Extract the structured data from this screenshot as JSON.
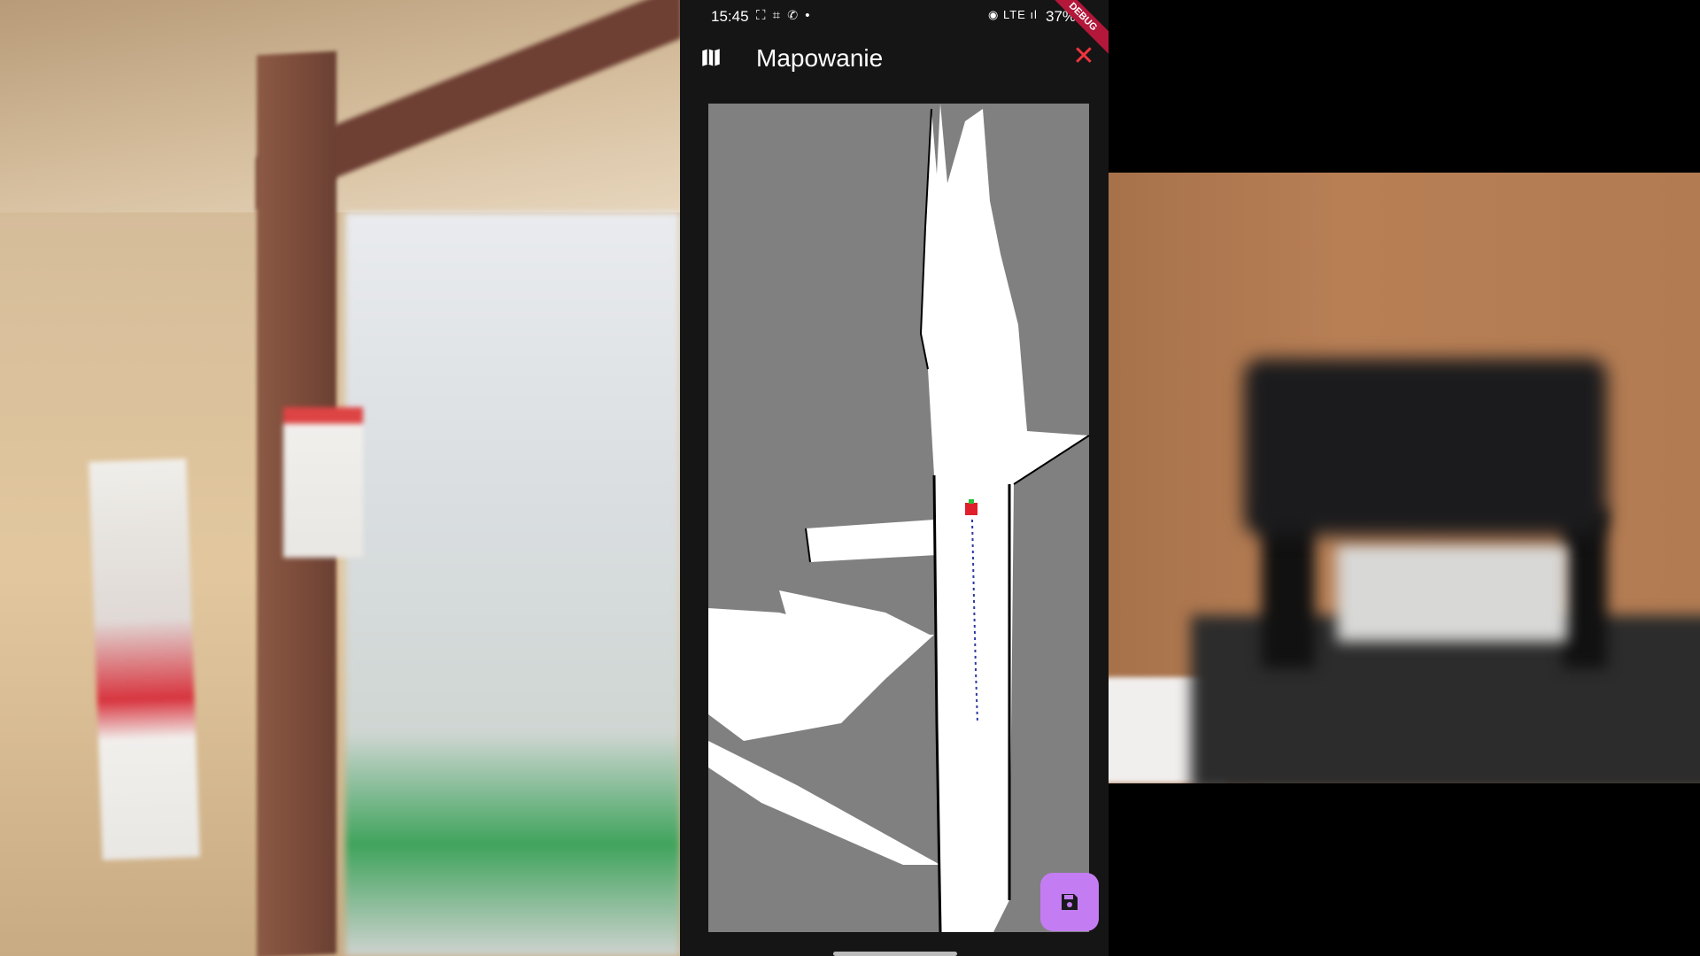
{
  "status_bar": {
    "time": "15:45",
    "left_icons": "⛶ ⌗ ✆ •",
    "right_icons": "◉ LTE ıl",
    "battery": "37%"
  },
  "debug_banner": "DEBUG",
  "app_bar": {
    "title": "Mapowanie",
    "leading_icon": "map-icon",
    "close_icon": "close-icon",
    "close_glyph": "✕"
  },
  "map": {
    "background_color": "#808080",
    "free_space_color": "#ffffff",
    "robot_marker_color": "#e0202a",
    "path_color": "#2a3aa0"
  },
  "fab": {
    "icon": "save-icon",
    "color": "#c47cf2"
  },
  "colors": {
    "phone_background": "#151515",
    "close_accent": "#f0353e",
    "debug_ribbon": "#b3173a"
  }
}
